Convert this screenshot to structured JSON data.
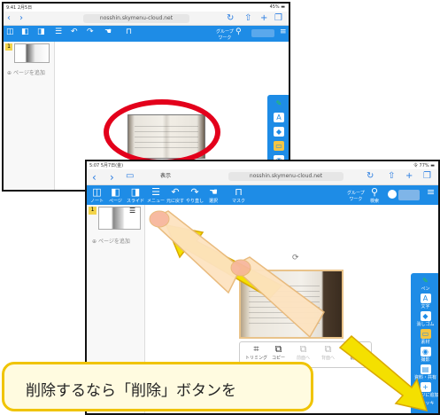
{
  "screenshot1": {
    "status_time": "9:41 2月5日",
    "status_right": "45% ▬",
    "url": "nosshin.skymenu-cloud.net",
    "toolbar": [
      "ノート",
      "ページ",
      "スライド",
      "メニュー",
      "元に戻す",
      "やり直し",
      "選択",
      "マスク"
    ],
    "group_label": "グループ\nワーク",
    "page_number": "1",
    "add_page": "ページを追加"
  },
  "screenshot2": {
    "status_time": "5:07 5月7日(金)",
    "status_right": "令 77% ▬",
    "tab": "表示",
    "url": "nosshin.skymenu-cloud.net",
    "toolbar": [
      {
        "icon": "◫",
        "label": "ノート"
      },
      {
        "icon": "◧",
        "label": "ページ"
      },
      {
        "icon": "◨",
        "label": "スライド"
      },
      {
        "icon": "☰",
        "label": "メニュー"
      },
      {
        "icon": "↶",
        "label": "元に戻す"
      },
      {
        "icon": "↷",
        "label": "やり直し"
      },
      {
        "icon": "☚",
        "label": "選択"
      },
      {
        "icon": "⊓",
        "label": "マスク"
      }
    ],
    "group_label": "グループ\nワーク",
    "search_label": "検索",
    "page_number": "1",
    "add_page": "ページを追加",
    "right_tools": [
      "ペン",
      "文字",
      "消しゴム",
      "素材",
      "撮影",
      "資料・共有",
      "ページに追加",
      "ステッキ"
    ],
    "bottom_actions": [
      {
        "icon": "⌗",
        "label": "トリミング"
      },
      {
        "icon": "⧉",
        "label": "コピー"
      },
      {
        "icon": "⧉",
        "label": "前面へ"
      },
      {
        "icon": "⧉",
        "label": "背面へ"
      },
      {
        "icon": "⌫",
        "label": "削除"
      }
    ]
  },
  "callout": {
    "text": "削除するなら「削除」ボタンを"
  },
  "colors": {
    "toolbar": "#1e8ce6",
    "highlight": "#e3001b",
    "arrow": "#f4e000",
    "callout_border": "#f0c400"
  }
}
